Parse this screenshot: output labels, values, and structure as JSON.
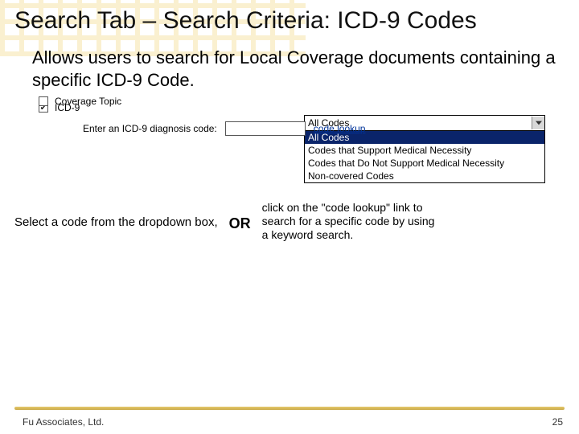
{
  "title": "Search Tab – Search Criteria: ICD-9 Codes",
  "intro": "Allows users to search for Local Coverage documents containing a specific ICD-9 Code.",
  "shot": {
    "icd9_label": "ICD-9",
    "enter_label": "Enter an ICD-9 diagnosis code:",
    "lookup_label": "code lookup",
    "coverage_label": "Coverage Topic",
    "dropdown_selected": "All Codes",
    "dropdown_items": {
      "0": "All Codes",
      "1": "Codes that Support Medical Necessity",
      "2": "Codes that Do Not Support Medical Necessity",
      "3": "Non-covered Codes"
    }
  },
  "callout_left": "Select a code from the dropdown box,",
  "or": "OR",
  "callout_right": "click on the \"code lookup\" link to search for a specific code by using a keyword search.",
  "footer_left": "Fu Associates, Ltd.",
  "footer_right": "25"
}
